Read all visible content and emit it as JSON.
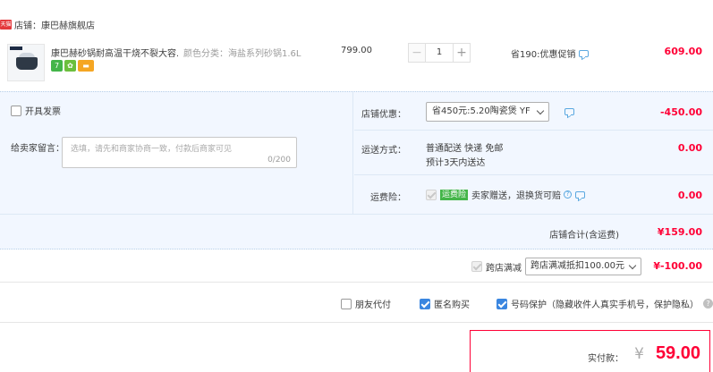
{
  "shop": {
    "badge": "天猫",
    "label": "店铺：康巴赫旗舰店"
  },
  "item": {
    "title": "康巴赫砂锅耐高温干烧不裂大容...",
    "sku": "颜色分类：海盐系列砂锅1.6L",
    "unit_price": "799.00",
    "quantity": "1",
    "minus": "−",
    "plus": "+",
    "promo": "省190:优惠促销",
    "total": "609.00",
    "badges": [
      "7",
      "✿",
      "▬"
    ]
  },
  "invoice": {
    "label": "开具发票"
  },
  "message": {
    "label": "给卖家留言：",
    "placeholder": "选填，请先和商家协商一致，付款后商家可见",
    "count": "0/200"
  },
  "coupon": {
    "label": "店铺优惠：",
    "selected": "省450元:5.20陶瓷煲 YF",
    "value": "-450.00"
  },
  "shipping": {
    "label": "运送方式：",
    "method": "普通配送 快递 免邮",
    "eta": "预计3天内送达",
    "value": "0.00"
  },
  "insurance": {
    "label": "运费险：",
    "tag": "运费险",
    "text": "卖家赠送，退换货可赔",
    "value": "0.00"
  },
  "shop_total": {
    "label": "店铺合计(含运费)",
    "value": "¥159.00"
  },
  "cross_store": {
    "label": "跨店满减",
    "selected": "跨店满减抵扣100.00元",
    "value": "¥-100.00"
  },
  "options": {
    "friend_pay": "朋友代付",
    "anonymous": "匿名购买",
    "privacy": "号码保护（隐藏收件人真实手机号，保护隐私）",
    "help": "?"
  },
  "payment": {
    "label": "实付款：",
    "currency": "¥",
    "amount": "59.00"
  }
}
